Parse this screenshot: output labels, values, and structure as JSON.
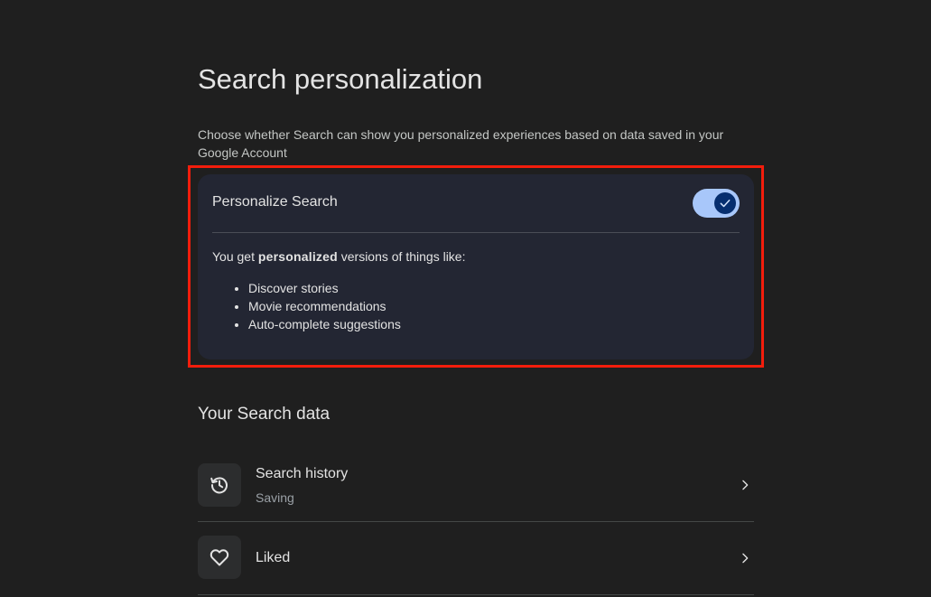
{
  "page": {
    "title": "Search personalization",
    "description": "Choose whether Search can show you personalized experiences based on data saved in your Google Account"
  },
  "personalize_card": {
    "title": "Personalize Search",
    "toggle_on": true,
    "body_prefix": "You get ",
    "body_bold": "personalized",
    "body_suffix": " versions of things like:",
    "items": [
      "Discover stories",
      "Movie recommendations",
      "Auto-complete suggestions"
    ]
  },
  "search_data": {
    "section_title": "Your Search data",
    "rows": [
      {
        "label": "Search history",
        "subtitle": "Saving",
        "icon": "history-icon"
      },
      {
        "label": "Liked",
        "subtitle": "",
        "icon": "heart-icon"
      }
    ]
  },
  "colors": {
    "background": "#1f1f1f",
    "card": "#232633",
    "toggle_track": "#a8c7fa",
    "toggle_knob": "#062e6f",
    "highlight": "#f21d0c"
  }
}
